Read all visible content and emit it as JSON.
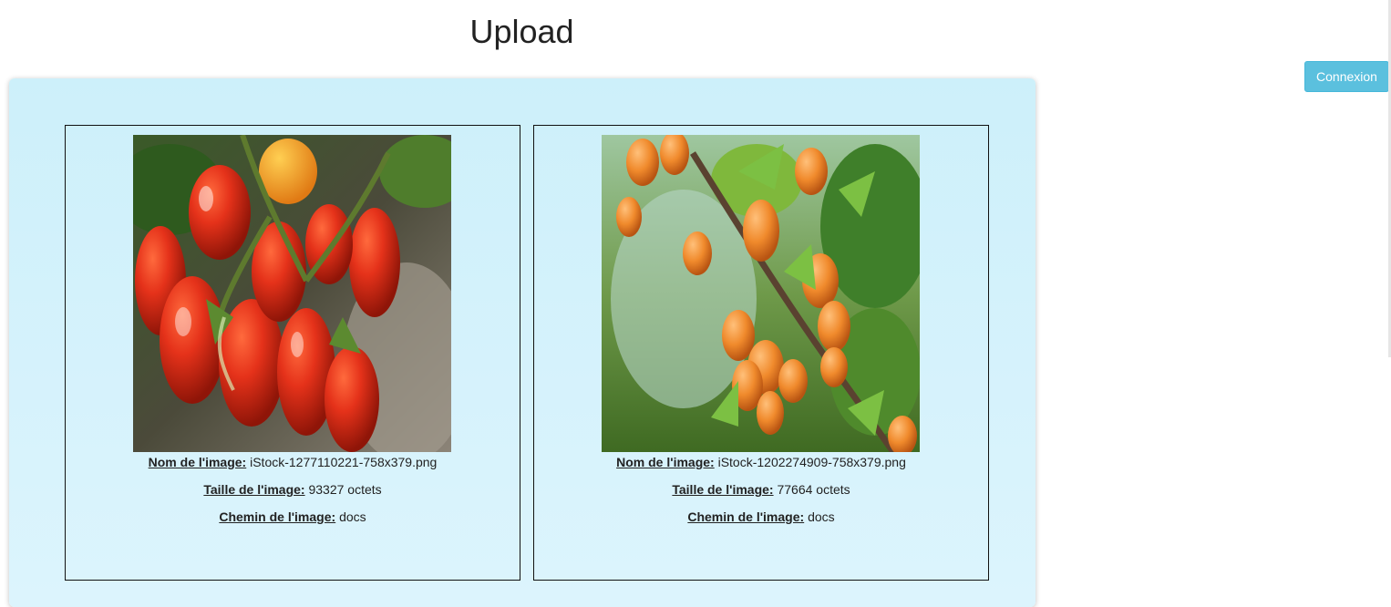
{
  "header": {
    "title": "Upload"
  },
  "auth": {
    "login_label": "Connexion"
  },
  "files": [
    {
      "name_label": "Nom de l'image:",
      "name": "iStock-1277110221-758x379.png",
      "size_label": "Taille de l'image:",
      "size": "93327 octets",
      "path_label": "Chemin de l'image:",
      "path": "docs",
      "thumbnail": "tomatoes-photo"
    },
    {
      "name_label": "Nom de l'image:",
      "name": "iStock-1202274909-758x379.png",
      "size_label": "Taille de l'image:",
      "size": "77664 octets",
      "path_label": "Chemin de l'image:",
      "path": "docs",
      "thumbnail": "apricots-photo"
    }
  ],
  "colors": {
    "panel_top": "#cdf0fa",
    "panel_bottom": "#dcf4fd",
    "button": "#5bc0de"
  }
}
